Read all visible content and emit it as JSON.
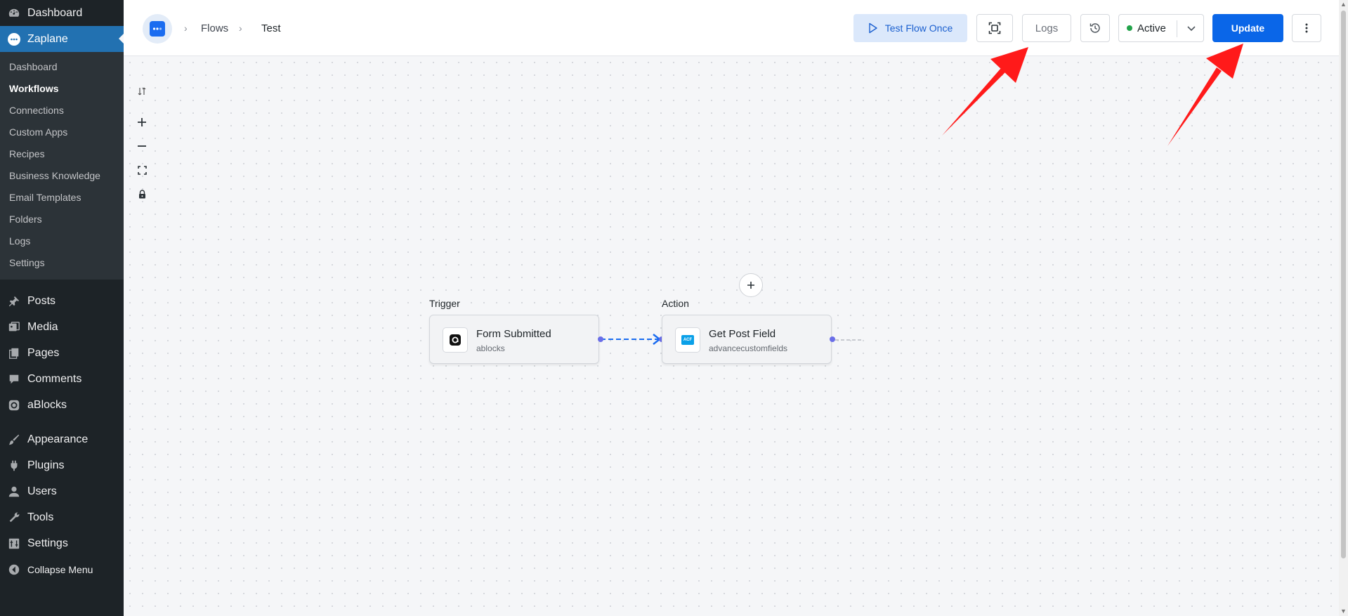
{
  "sidebar": {
    "top_items": [
      {
        "label": "Dashboard",
        "icon": "dashboard-icon"
      },
      {
        "label": "Zaplane",
        "icon": "zaplane-icon"
      }
    ],
    "submenu": [
      "Dashboard",
      "Workflows",
      "Connections",
      "Custom Apps",
      "Recipes",
      "Business Knowledge",
      "Email Templates",
      "Folders",
      "Logs",
      "Settings"
    ],
    "current_submenu": "Workflows",
    "items": [
      {
        "label": "Posts",
        "icon": "pin-icon"
      },
      {
        "label": "Media",
        "icon": "media-icon"
      },
      {
        "label": "Pages",
        "icon": "pages-icon"
      },
      {
        "label": "Comments",
        "icon": "comment-icon"
      },
      {
        "label": "aBlocks",
        "icon": "ablocks-icon"
      },
      {
        "label": "Appearance",
        "icon": "brush-icon"
      },
      {
        "label": "Plugins",
        "icon": "plug-icon"
      },
      {
        "label": "Users",
        "icon": "user-icon"
      },
      {
        "label": "Tools",
        "icon": "wrench-icon"
      },
      {
        "label": "Settings",
        "icon": "settings-icon"
      },
      {
        "label": "Collapse Menu",
        "icon": "collapse-icon"
      }
    ]
  },
  "header": {
    "breadcrumb": [
      "Flows",
      "Test"
    ],
    "test_flow_label": "Test Flow Once",
    "logs_label": "Logs",
    "status_label": "Active",
    "update_label": "Update"
  },
  "canvas": {
    "trigger": {
      "section": "Trigger",
      "title": "Form Submitted",
      "app": "ablocks"
    },
    "action": {
      "section": "Action",
      "title": "Get Post Field",
      "app": "advancecustomfields",
      "icon_text": "ACF"
    }
  },
  "colors": {
    "sidebar_bg": "#1d2327",
    "accent": "#2271b1",
    "update_button": "#0a66e8",
    "status_active": "#22a34a",
    "annotation_arrow": "#ff1a1a"
  }
}
